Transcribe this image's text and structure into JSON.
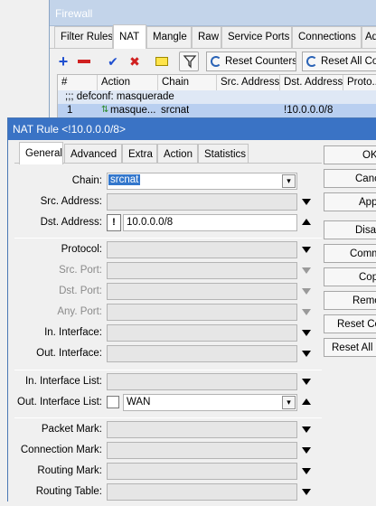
{
  "firewall": {
    "title": "Firewall",
    "tabs": [
      "Filter Rules",
      "NAT",
      "Mangle",
      "Raw",
      "Service Ports",
      "Connections",
      "Ad"
    ],
    "active_tab": "NAT",
    "toolbar": {
      "reset_counters": "Reset Counters",
      "reset_all_counters": "Reset All Co"
    },
    "table": {
      "headers": [
        "#",
        "Action",
        "Chain",
        "Src. Address",
        "Dst. Address",
        "Proto..."
      ],
      "comment": ";;; defconf: masquerade",
      "row": {
        "num": "1",
        "action": "masque...",
        "chain": "srcnat",
        "dst_address": "!10.0.0.0/8"
      }
    }
  },
  "nat_rule": {
    "title": "NAT Rule <!10.0.0.0/8>",
    "tabs": [
      "General",
      "Advanced",
      "Extra",
      "Action",
      "Statistics"
    ],
    "active_tab": "General",
    "fields": {
      "chain": {
        "label": "Chain:",
        "value": "srcnat"
      },
      "src_address": {
        "label": "Src. Address:",
        "value": ""
      },
      "dst_address": {
        "label": "Dst. Address:",
        "value": "10.0.0.0/8",
        "not": "!"
      },
      "protocol": {
        "label": "Protocol:",
        "value": ""
      },
      "src_port": {
        "label": "Src. Port:",
        "value": ""
      },
      "dst_port": {
        "label": "Dst. Port:",
        "value": ""
      },
      "any_port": {
        "label": "Any. Port:",
        "value": ""
      },
      "in_interface": {
        "label": "In. Interface:",
        "value": ""
      },
      "out_interface": {
        "label": "Out. Interface:",
        "value": ""
      },
      "in_interface_list": {
        "label": "In. Interface List:",
        "value": ""
      },
      "out_interface_list": {
        "label": "Out. Interface List:",
        "value": "WAN"
      },
      "packet_mark": {
        "label": "Packet Mark:",
        "value": ""
      },
      "connection_mark": {
        "label": "Connection Mark:",
        "value": ""
      },
      "routing_mark": {
        "label": "Routing Mark:",
        "value": ""
      },
      "routing_table": {
        "label": "Routing Table:",
        "value": ""
      }
    },
    "buttons": {
      "ok": "OK",
      "cancel": "Cancel",
      "apply": "Apply",
      "disable": "Disable",
      "comment": "Comment",
      "copy": "Copy",
      "remove": "Remove",
      "reset_counters": "Reset Counters",
      "reset_all_counters": "Reset All Counters"
    }
  }
}
